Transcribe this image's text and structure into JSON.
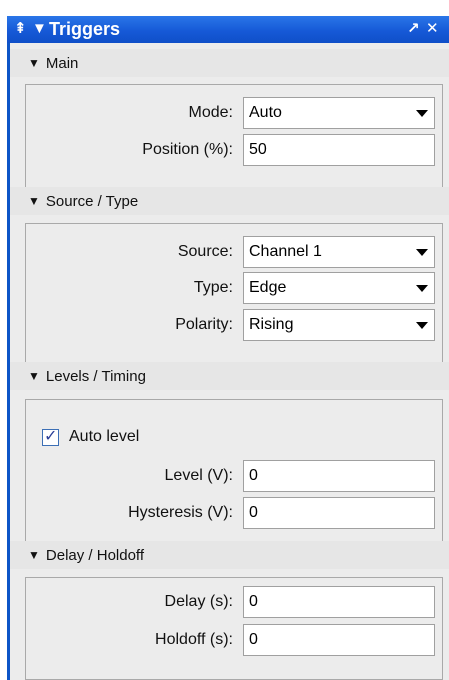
{
  "titlebar": {
    "title": "Triggers",
    "pin_icon": "pin-icon",
    "collapse_icon": "triangle-down-icon",
    "undock_icon": "undock-arrow-icon",
    "close_icon": "close-icon"
  },
  "sections": {
    "main": {
      "title": "Main",
      "mode_label": "Mode:",
      "mode_value": "Auto",
      "position_label": "Position (%):",
      "position_value": "50"
    },
    "source_type": {
      "title": "Source / Type",
      "source_label": "Source:",
      "source_value": "Channel 1",
      "type_label": "Type:",
      "type_value": "Edge",
      "polarity_label": "Polarity:",
      "polarity_value": "Rising"
    },
    "levels_timing": {
      "title": "Levels / Timing",
      "auto_level_label": "Auto level",
      "auto_level_checked": true,
      "level_label": "Level (V):",
      "level_value": "0",
      "hysteresis_label": "Hysteresis (V):",
      "hysteresis_value": "0"
    },
    "delay_holdoff": {
      "title": "Delay / Holdoff",
      "delay_label": "Delay (s):",
      "delay_value": "0",
      "holdoff_label": "Holdoff (s):",
      "holdoff_value": "0"
    }
  },
  "colors": {
    "title_bar": "#1659d7",
    "panel_background": "#ececec",
    "field_background": "#ffffff"
  }
}
